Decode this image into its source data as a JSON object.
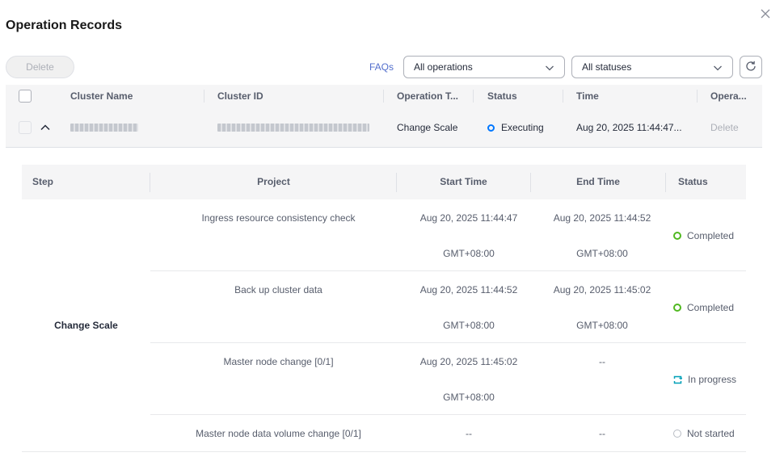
{
  "dialog": {
    "title": "Operation Records"
  },
  "toolbar": {
    "delete_label": "Delete",
    "faqs_label": "FAQs",
    "operations_filter": "All operations",
    "status_filter": "All statuses"
  },
  "table": {
    "headers": {
      "cluster_name": "Cluster Name",
      "cluster_id": "Cluster ID",
      "operation_type": "Operation T...",
      "status": "Status",
      "time": "Time",
      "operation": "Opera..."
    },
    "row": {
      "operation_type": "Change Scale",
      "status": "Executing",
      "time": "Aug 20, 2025 11:44:47...",
      "delete_label": "Delete"
    }
  },
  "steps": {
    "headers": {
      "step": "Step",
      "project": "Project",
      "start_time": "Start Time",
      "end_time": "End Time",
      "status": "Status"
    },
    "step_name": "Change Scale",
    "rows": [
      {
        "project": "Ingress resource consistency check",
        "start_date": "Aug 20, 2025 11:44:47",
        "start_tz": "GMT+08:00",
        "end_date": "Aug 20, 2025 11:44:52",
        "end_tz": "GMT+08:00",
        "status": "Completed"
      },
      {
        "project": "Back up cluster data",
        "start_date": "Aug 20, 2025 11:44:52",
        "start_tz": "GMT+08:00",
        "end_date": "Aug 20, 2025 11:45:02",
        "end_tz": "GMT+08:00",
        "status": "Completed"
      },
      {
        "project": "Master node change  [0/1]",
        "start_date": "Aug 20, 2025 11:45:02",
        "start_tz": "GMT+08:00",
        "end_date": "--",
        "end_tz": "",
        "status": "In progress"
      },
      {
        "project": "Master node data volume change  [0/1]",
        "start_date": "--",
        "start_tz": "",
        "end_date": "--",
        "end_tz": "",
        "status": "Not started"
      }
    ]
  },
  "colors": {
    "executing": "#0077ff",
    "completed": "#50b820",
    "in_progress": "#00a0b8",
    "not_started": "#b8bcc4",
    "link": "#526ecc"
  }
}
